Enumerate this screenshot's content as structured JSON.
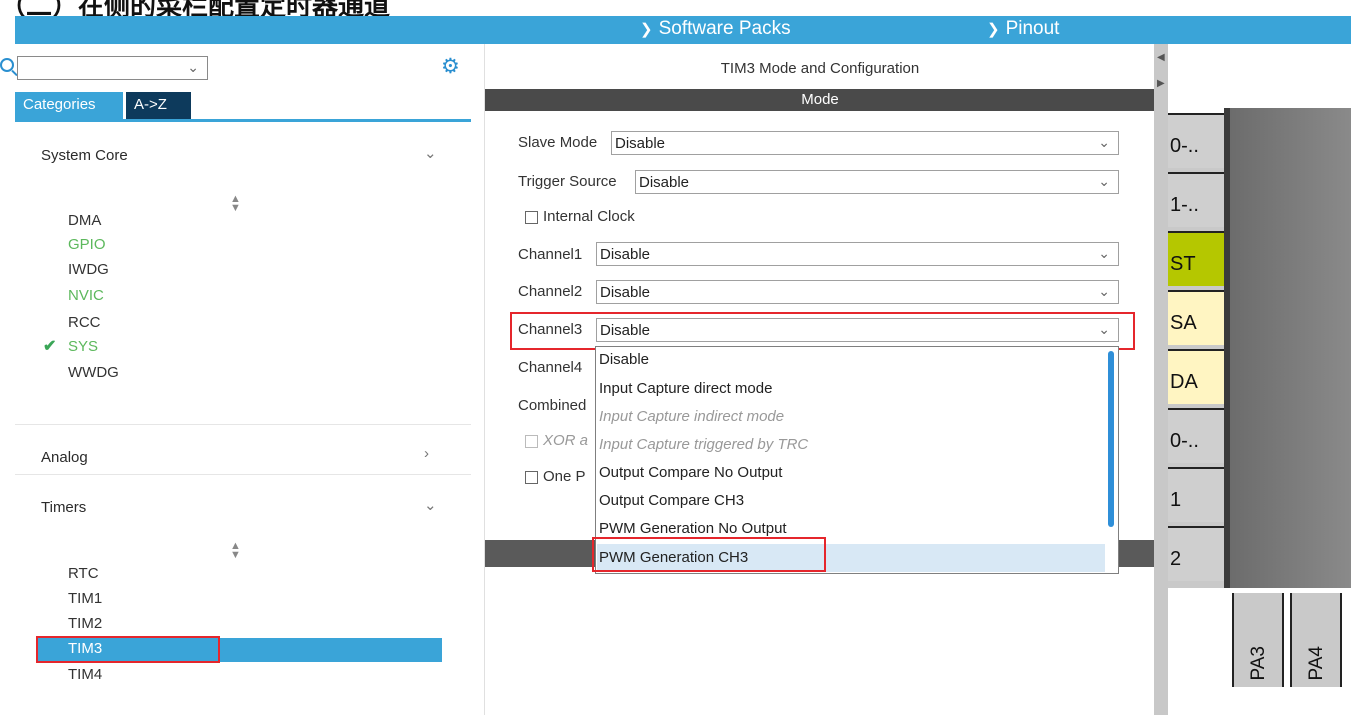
{
  "caption": {
    "text": "（二）在侧的菜栏配置定时器通道"
  },
  "topbar": {
    "software_packs": "Software Packs",
    "pinout": "Pinout"
  },
  "sidebar": {
    "tabs": [
      "Categories",
      "A->Z"
    ],
    "categories": {
      "system_core": "System Core",
      "analog": "Analog",
      "timers": "Timers"
    },
    "system_core_items": [
      "DMA",
      "GPIO",
      "IWDG",
      "NVIC",
      "RCC",
      "SYS",
      "WWDG"
    ],
    "timers_items": [
      "RTC",
      "TIM1",
      "TIM2",
      "TIM3",
      "TIM4"
    ],
    "selected_item": "TIM3"
  },
  "config": {
    "title": "TIM3 Mode and Configuration",
    "mode_header": "Mode",
    "slave_mode_label": "Slave Mode",
    "slave_mode_value": "Disable",
    "trigger_source_label": "Trigger Source",
    "trigger_source_value": "Disable",
    "internal_clock_label": "Internal Clock",
    "channel1_label": "Channel1",
    "channel1_value": "Disable",
    "channel2_label": "Channel2",
    "channel2_value": "Disable",
    "channel3_label": "Channel3",
    "channel3_value": "Disable",
    "channel4_label": "Channel4",
    "combined_label": "Combined",
    "xor_label": "XOR a",
    "one_pulse_label": "One P"
  },
  "dropdown": {
    "options": [
      {
        "label": "Disable",
        "disabled": false
      },
      {
        "label": "Input Capture direct mode",
        "disabled": false
      },
      {
        "label": "Input Capture indirect mode",
        "disabled": true
      },
      {
        "label": "Input Capture triggered by TRC",
        "disabled": true
      },
      {
        "label": "Output Compare No Output",
        "disabled": false
      },
      {
        "label": "Output Compare CH3",
        "disabled": false
      },
      {
        "label": "PWM Generation No Output",
        "disabled": false
      },
      {
        "label": "PWM Generation CH3",
        "disabled": false
      }
    ],
    "highlighted": "PWM Generation CH3"
  },
  "pinout": {
    "side_pins": [
      "0-..",
      "1-..",
      "ST",
      "SA",
      "DA",
      "0-..",
      "1",
      "2"
    ],
    "bottom_pins": [
      "PA3",
      "PA4"
    ]
  },
  "colors": {
    "accent": "#3aa4d8",
    "selected_pin": "#b5c700",
    "highlight_box": "#e5262c"
  }
}
